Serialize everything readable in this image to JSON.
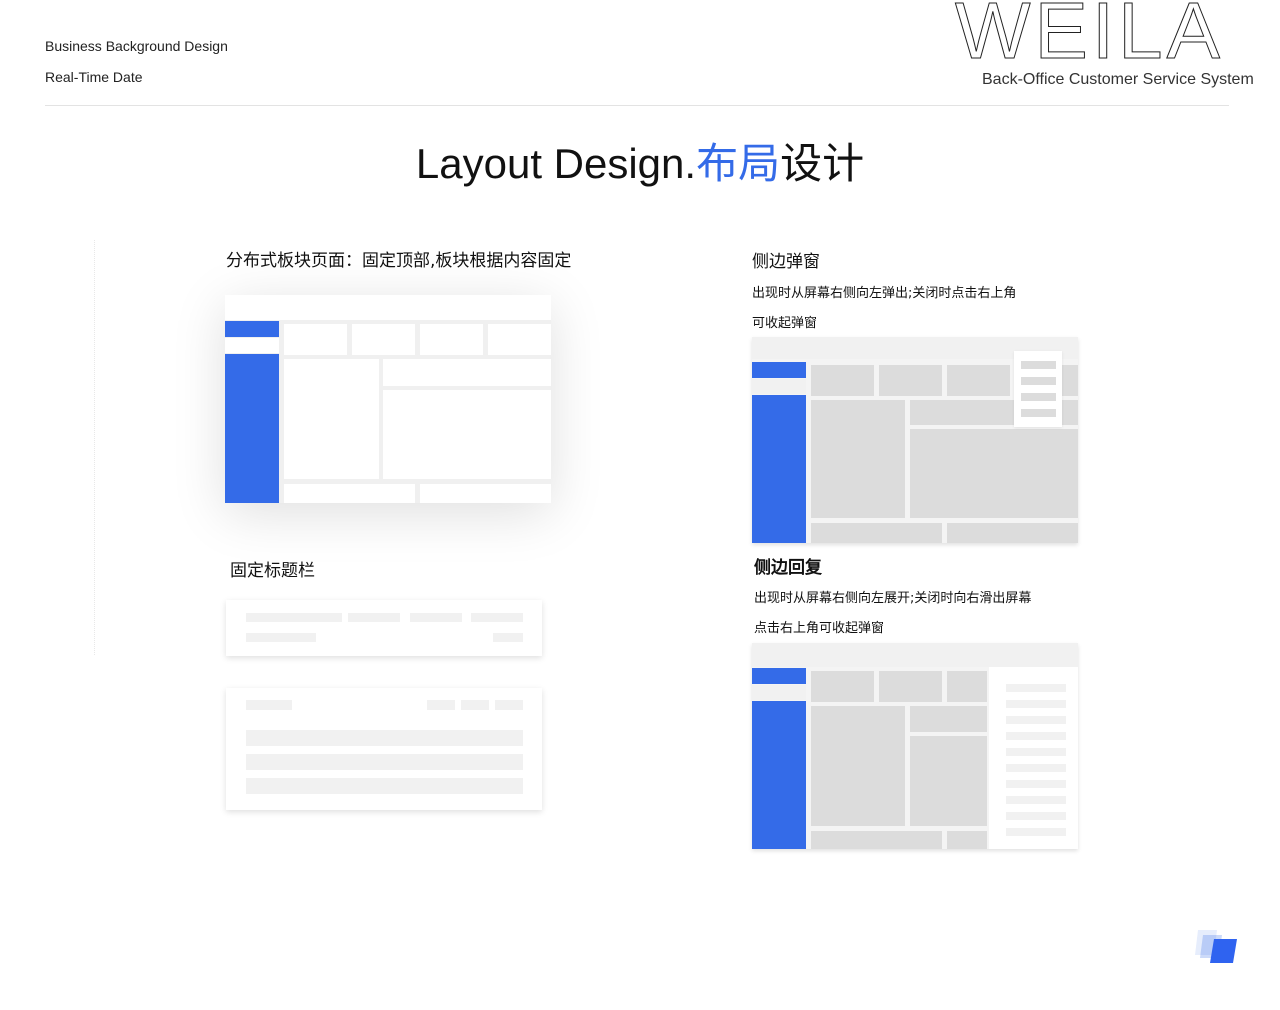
{
  "header": {
    "line1": "Business Background Design",
    "line2": "Real-Time Date",
    "logo_text": "WEILA",
    "subtitle": "Back-Office Customer Service System"
  },
  "title": {
    "en": "Layout Design.",
    "cn_accent": "布局",
    "cn_rest": "设计"
  },
  "sections": {
    "distributed": {
      "heading": "分布式板块页面：固定顶部,板块根据内容固定"
    },
    "fixed_title": {
      "heading": "固定标题栏"
    },
    "side_popup": {
      "heading": "侧边弹窗",
      "desc1": "出现时从屏幕右侧向左弹出;关闭时点击右上角",
      "desc2": "可收起弹窗"
    },
    "side_reply": {
      "heading": "侧边回复",
      "desc1": "出现时从屏幕右侧向左展开;关闭时向右滑出屏幕",
      "desc2": "点击右上角可收起弹窗"
    }
  },
  "colors": {
    "accent": "#346be8",
    "placeholder": "#dcdcdc"
  }
}
